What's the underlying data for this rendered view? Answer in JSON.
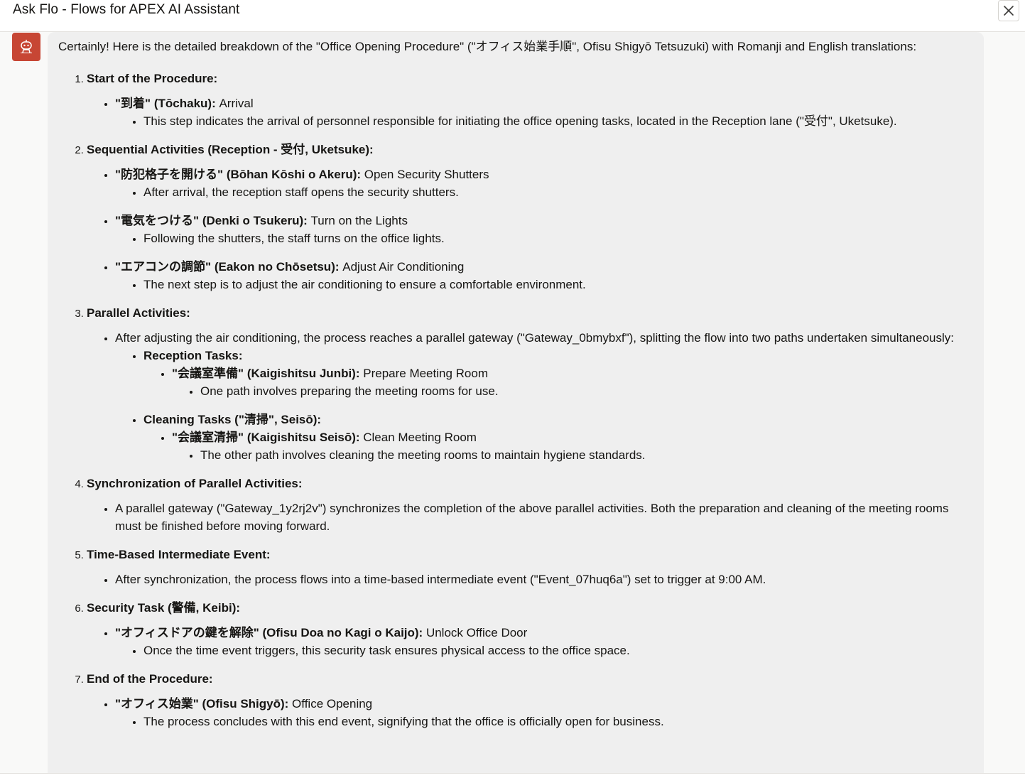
{
  "window": {
    "title": "Ask Flo - Flows for APEX AI Assistant"
  },
  "icons": {
    "close": "close-icon",
    "avatar": "assistant-robot-icon"
  },
  "colors": {
    "avatar_bg": "#c74634",
    "bubble_bg": "#efefef"
  },
  "message": {
    "intro": "Certainly! Here is the detailed breakdown of the \"Office Opening Procedure\" (\"オフィス始業手順\", Ofisu Shigyō Tetsuzuki) with Romanji and English translations:",
    "steps": [
      {
        "title": "Start of the Procedure:",
        "items": [
          {
            "term": "\"到着\" (Tōchaku):",
            "desc": " Arrival",
            "detail": "This step indicates the arrival of personnel responsible for initiating the office opening tasks, located in the Reception lane (\"受付\", Uketsuke)."
          }
        ]
      },
      {
        "title": "Sequential Activities (Reception - 受付, Uketsuke):",
        "items": [
          {
            "term": "\"防犯格子を開ける\" (Bōhan Kōshi o Akeru):",
            "desc": " Open Security Shutters",
            "detail": "After arrival, the reception staff opens the security shutters."
          },
          {
            "term": "\"電気をつける\" (Denki o Tsukeru):",
            "desc": " Turn on the Lights",
            "detail": "Following the shutters, the staff turns on the office lights."
          },
          {
            "term": "\"エアコンの調節\" (Eakon no Chōsetsu):",
            "desc": " Adjust Air Conditioning",
            "detail": "The next step is to adjust the air conditioning to ensure a comfortable environment."
          }
        ]
      },
      {
        "title": "Parallel Activities:",
        "text": "After adjusting the air conditioning, the process reaches a parallel gateway (\"Gateway_0bmybxf\"), splitting the flow into two paths undertaken simultaneously:",
        "groups": [
          {
            "title": "Reception Tasks:",
            "term": "\"会議室準備\" (Kaigishitsu Junbi):",
            "desc": " Prepare Meeting Room",
            "detail": "One path involves preparing the meeting rooms for use."
          },
          {
            "title": "Cleaning Tasks (\"清掃\", Seisō):",
            "term": "\"会議室清掃\" (Kaigishitsu Seisō):",
            "desc": " Clean Meeting Room",
            "detail": "The other path involves cleaning the meeting rooms to maintain hygiene standards."
          }
        ]
      },
      {
        "title": "Synchronization of Parallel Activities:",
        "text": "A parallel gateway (\"Gateway_1y2rj2v\") synchronizes the completion of the above parallel activities. Both the preparation and cleaning of the meeting rooms must be finished before moving forward."
      },
      {
        "title": "Time-Based Intermediate Event:",
        "text": "After synchronization, the process flows into a time-based intermediate event (\"Event_07huq6a\") set to trigger at 9:00 AM."
      },
      {
        "title": "Security Task (警備, Keibi):",
        "items": [
          {
            "term": "\"オフィスドアの鍵を解除\" (Ofisu Doa no Kagi o Kaijo):",
            "desc": " Unlock Office Door",
            "detail": "Once the time event triggers, this security task ensures physical access to the office space."
          }
        ]
      },
      {
        "title": "End of the Procedure:",
        "items": [
          {
            "term": "\"オフィス始業\" (Ofisu Shigyō):",
            "desc": " Office Opening",
            "detail": "The process concludes with this end event, signifying that the office is officially open for business."
          }
        ]
      }
    ]
  }
}
